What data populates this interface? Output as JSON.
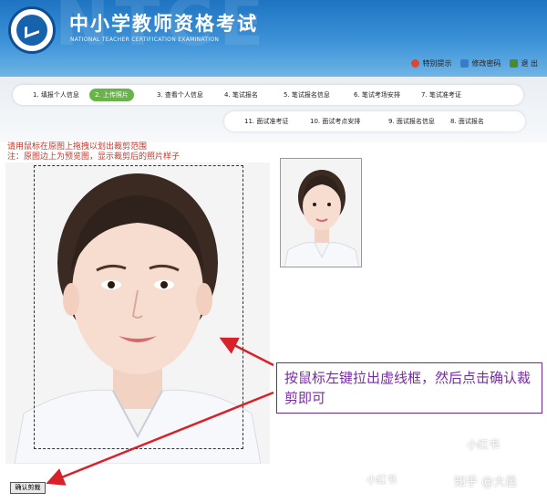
{
  "header": {
    "bg_text": "NTCE",
    "title": "中小学教师资格考试",
    "subtitle": "NATIONAL TEACHER CERTIFICATION EXAMINATION",
    "links": [
      {
        "label": "特别提示",
        "icon": "warning-icon",
        "color": "#e0452d"
      },
      {
        "label": "修改密码",
        "icon": "key-icon",
        "color": "#3a7bc8"
      },
      {
        "label": "退 出",
        "icon": "exit-icon",
        "color": "#4a8a2a"
      }
    ]
  },
  "steps_row1": [
    "1. 填报个人信息",
    "2. 上传照片",
    "3. 查看个人信息",
    "4. 笔试报名",
    "5. 笔试报名信息",
    "6. 笔试考场安排",
    "7. 笔试准考证"
  ],
  "steps_row2": [
    "11. 面试准考证",
    "10. 面试考点安排",
    "9. 面试报名信息",
    "8. 面试报名"
  ],
  "active_step": "2. 上传照片",
  "instructions": {
    "line1": "请用鼠标在原图上拖拽以划出裁剪范围",
    "line2": "注：原图边上为预览图，显示裁剪后的照片样子"
  },
  "callout": {
    "text": "按鼠标左键拉出虚线框，然后点击确认裁剪即可"
  },
  "confirm_button": "确认剪裁",
  "watermarks": {
    "xhs": "小红书",
    "zhihu": "知乎 @大邑",
    "mid": "小红书"
  },
  "colors": {
    "header_blue": "#2f85cf",
    "active_green": "#6ab34a",
    "callout_purple": "#7a2aa6",
    "arrow_red": "#d8222a"
  }
}
